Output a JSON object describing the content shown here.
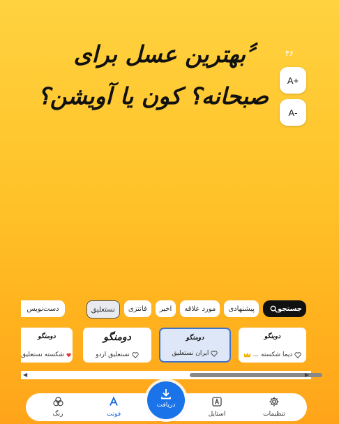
{
  "quote": {
    "text": "〞بهترین عسل برای صبحانه؟ کون یا آویشن؟"
  },
  "counter": "۴۶",
  "size_buttons": {
    "increase": "A+",
    "decrease": "A-"
  },
  "filters": [
    {
      "label": "جستجو",
      "icon": "search-icon",
      "style": "black"
    },
    {
      "label": "پیشنهادی",
      "style": "normal"
    },
    {
      "label": "مورد علاقه",
      "style": "normal"
    },
    {
      "label": "اخیر",
      "style": "normal"
    },
    {
      "label": "فانتزی",
      "style": "normal"
    },
    {
      "label": "نستعلیق",
      "style": "selected"
    }
  ],
  "filters_overflow": "دست‌نویس",
  "font_cards": [
    {
      "preview": "دوبنگو",
      "label": "دیما شکسته ...",
      "badge": "crown-icon",
      "favorite": false
    },
    {
      "preview": "دومنگو",
      "label": "ایران نستعلیق",
      "favorite": false,
      "selected": true
    },
    {
      "preview": "دومنگو",
      "label": "نستعلیق اردو",
      "favorite": false
    },
    {
      "preview": "دومنگو",
      "label": "شکسته نستعلیق",
      "favorite": true
    }
  ],
  "nav": {
    "settings": "تنظیمات",
    "style": "استایل",
    "download": "دریافت",
    "font": "فونت",
    "color": "رنگ"
  },
  "colors": {
    "accent": "#1A73E8",
    "favorite": "#E53935",
    "crown": "#F4B400"
  }
}
